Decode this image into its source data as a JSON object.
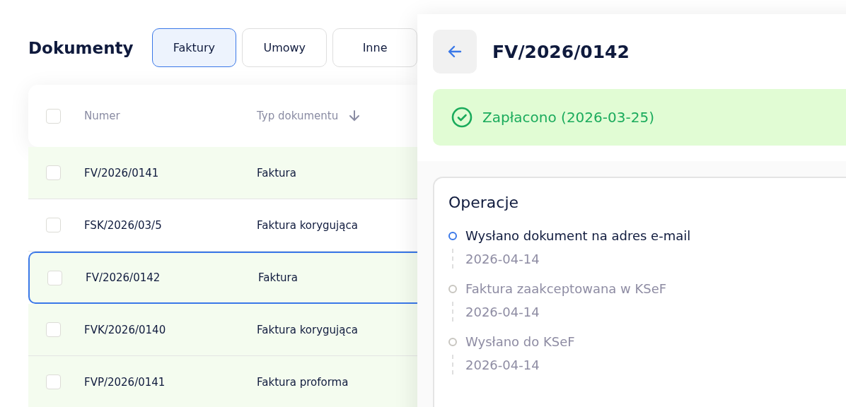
{
  "page": {
    "title": "Dokumenty"
  },
  "tabs": [
    {
      "label": "Faktury",
      "selected": true
    },
    {
      "label": "Umowy",
      "selected": false
    },
    {
      "label": "Inne",
      "selected": false
    }
  ],
  "table": {
    "all_checked": false,
    "columns": [
      {
        "label": "Numer",
        "sorted": false
      },
      {
        "label": "Typ dokumentu",
        "sorted": true
      }
    ],
    "rows": [
      {
        "number": "FV/2026/0141",
        "type": "Faktura",
        "checked": false,
        "paid": true,
        "selected": false
      },
      {
        "number": "FSK/2026/03/5",
        "type": "Faktura korygująca",
        "checked": false,
        "paid": false,
        "selected": false
      },
      {
        "number": "FV/2026/0142",
        "type": "Faktura",
        "checked": false,
        "paid": true,
        "selected": true
      },
      {
        "number": "FVK/2026/0140",
        "type": "Faktura korygująca",
        "checked": false,
        "paid": true,
        "selected": false
      },
      {
        "number": "FVP/2026/0141",
        "type": "Faktura proforma",
        "checked": false,
        "paid": true,
        "selected": false
      }
    ]
  },
  "detail": {
    "title": "FV/2026/0142",
    "status": {
      "text": "Zapłacono (2026-03-25)"
    },
    "operations": {
      "title": "Operacje",
      "events": [
        {
          "label": "Wysłano dokument na adres e-mail",
          "date": "2026-04-14",
          "active": true
        },
        {
          "label": "Faktura zaakceptowana w KSeF",
          "date": "2026-04-14",
          "active": false
        },
        {
          "label": "Wysłano do KSeF",
          "date": "2026-04-14",
          "active": false
        }
      ]
    }
  }
}
